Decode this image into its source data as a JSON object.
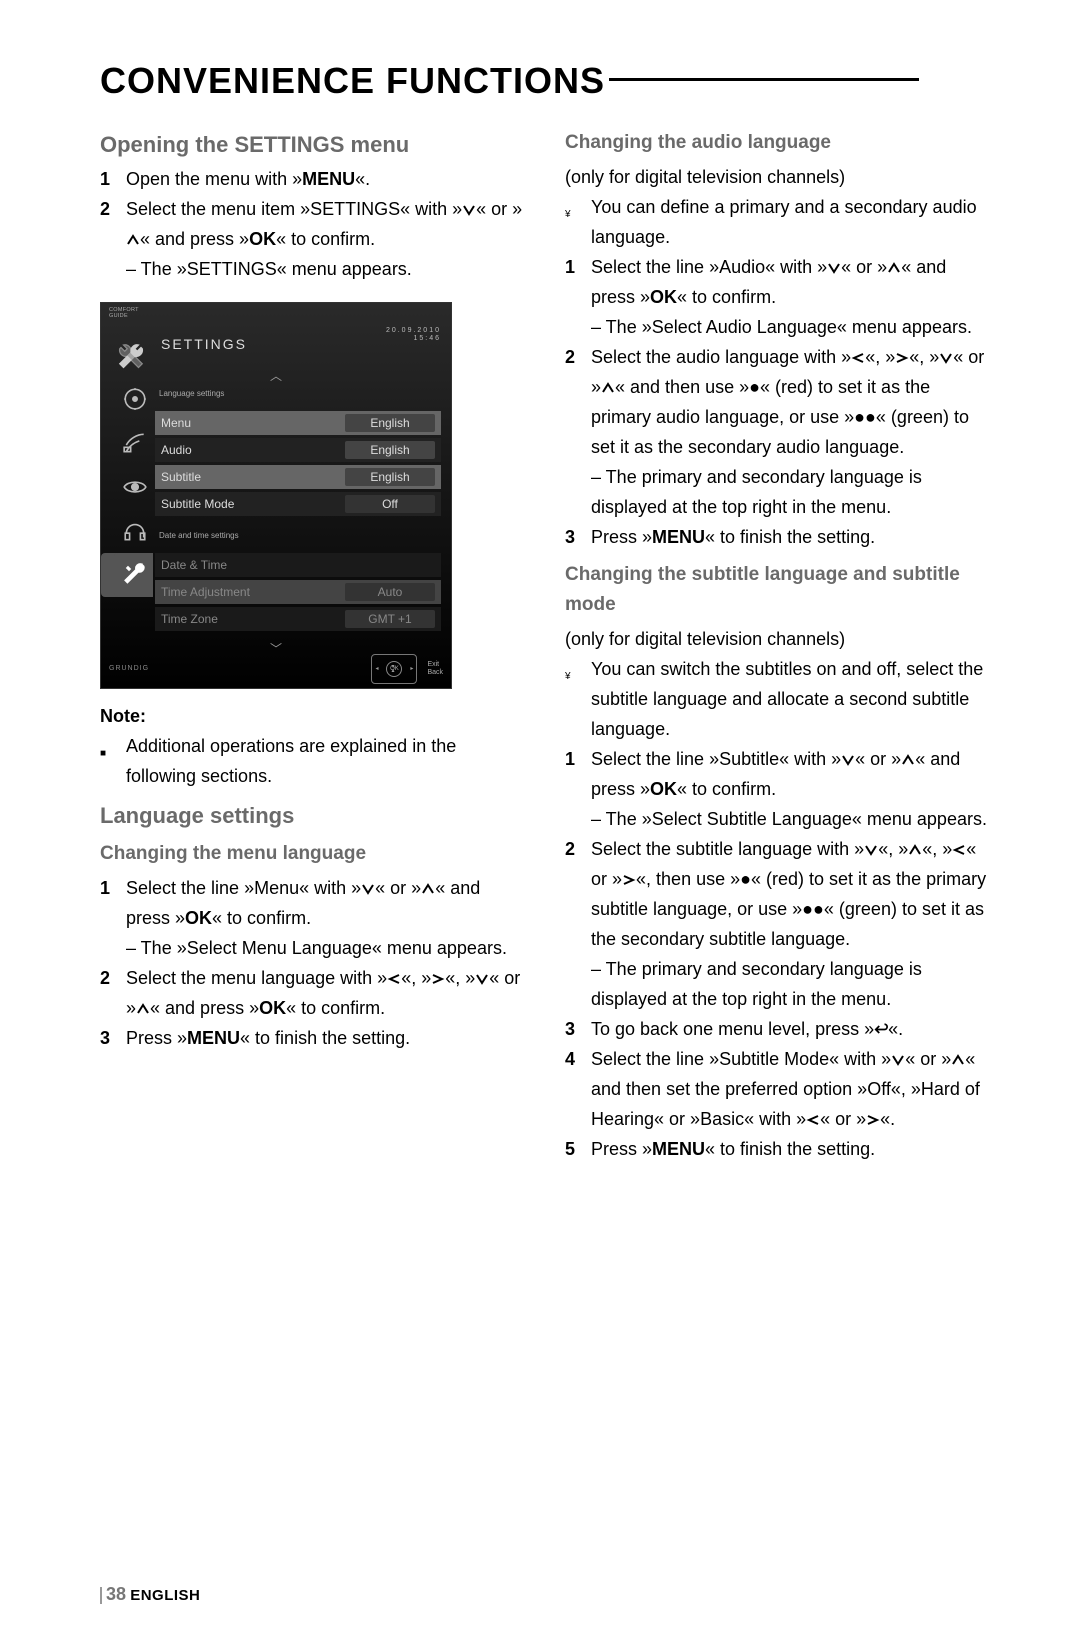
{
  "page_title": "CONVENIENCE FUNCTIONS",
  "left": {
    "h_open": "Opening the SETTINGS menu",
    "s1": {
      "n": "1",
      "txt": "Open the menu with »",
      "menu": "MENU",
      "end": "«."
    },
    "s2": {
      "n": "2",
      "a": "Select the menu item »SETTINGS« with »",
      "b": "« or »",
      "c": "« and press »",
      "ok": "OK",
      "d": "« to confirm.",
      "e": "– The »SETTINGS« menu appears."
    },
    "note_lbl": "Note:",
    "note_txt": "Additional operations are explained in the following sections.",
    "h_lang": "Language settings",
    "h_menu_lang": "Changing the menu language",
    "ml1": {
      "n": "1",
      "a": "Select the line »Menu« with »",
      "b": "« or »",
      "c": "« and press »",
      "ok": "OK",
      "d": "« to confirm.",
      "e": "– The »Select Menu Language« menu appears."
    },
    "ml2": {
      "n": "2",
      "a": "Select the menu language with »",
      "b": "«, »",
      "c": "«, »",
      "d": "« or »",
      "e": "« and press »",
      "ok": "OK",
      "f": "« to confirm."
    },
    "ml3": {
      "n": "3",
      "a": "Press »",
      "menu": "MENU",
      "b": "« to finish the setting."
    }
  },
  "right": {
    "h_audio": "Changing the audio language",
    "a_note": "(only for digital television channels)",
    "a_def": "You can define a primary and a secondary audio language.",
    "a1": {
      "n": "1",
      "a": "Select the line »Audio« with »",
      "b": "« or »",
      "c": "« and press »",
      "ok": "OK",
      "d": "« to confirm.",
      "e": "– The »Select Audio Language« menu appears."
    },
    "a2": {
      "n": "2",
      "a": "Select the audio language with »",
      "b": "«, »",
      "c": "«, »",
      "d": "« or »",
      "e": "« and then use »",
      "red": "●",
      "f": "« (red) to set it as the primary audio language, or use »",
      "green": "●●",
      "g": "« (green) to set it as the secondary audio language.",
      "h": "– The primary and secondary language is displayed at the top right in the menu."
    },
    "a3": {
      "n": "3",
      "a": "Press »",
      "menu": "MENU",
      "b": "« to finish the setting."
    },
    "h_sub": "Changing the subtitle language and subtitle mode",
    "s_note": "(only for digital television channels)",
    "s_def": "You can switch the subtitles on and off, select the subtitle language and allocate a second subtitle language.",
    "s1": {
      "n": "1",
      "a": "Select the line »Subtitle« with »",
      "b": "« or »",
      "c": "« and press »",
      "ok": "OK",
      "d": "« to confirm.",
      "e": "– The »Select Subtitle Language« menu appears."
    },
    "s2": {
      "n": "2",
      "a": "Select the subtitle language with »",
      "b": "«, »",
      "c": "«, »",
      "d": "« or »",
      "e": "«, then use »",
      "f": "« (red) to set it as the primary subtitle language, or use »",
      "g": "« (green) to set it as the secondary subtitle language.",
      "h": "– The primary and secondary language is displayed at the top right in the menu."
    },
    "s3": {
      "n": "3",
      "a": "To go back one menu level, press »",
      "b": "«."
    },
    "s4": {
      "n": "4",
      "a": "Select the line »Subtitle Mode« with »",
      "b": "« or »",
      "c": "« and then set the preferred option »Off«, »Hard of Hearing« or »Basic« with »",
      "d": "« or »",
      "e": "«."
    },
    "s5": {
      "n": "5",
      "a": "Press »",
      "menu": "MENU",
      "b": "« to finish the setting."
    }
  },
  "tv": {
    "comfort": "COMFORT",
    "guide": "GUIDE",
    "header": "SETTINGS",
    "date": "20.09.2010",
    "time": "15:46",
    "grp1": "Language settings",
    "r_menu": "Menu",
    "r_audio": "Audio",
    "r_sub": "Subtitle",
    "r_mode": "Subtitle Mode",
    "v_en": "English",
    "v_off": "Off",
    "grp2": "Date and time settings",
    "r_dt": "Date & Time",
    "r_ta": "Time Adjustment",
    "r_tz": "Time Zone",
    "v_auto": "Auto",
    "v_gmt": "GMT +1",
    "brand": "GRUNDIG",
    "exit": "Exit",
    "back": "Back"
  },
  "footer": {
    "page": "38",
    "lang": "ENGLISH"
  }
}
